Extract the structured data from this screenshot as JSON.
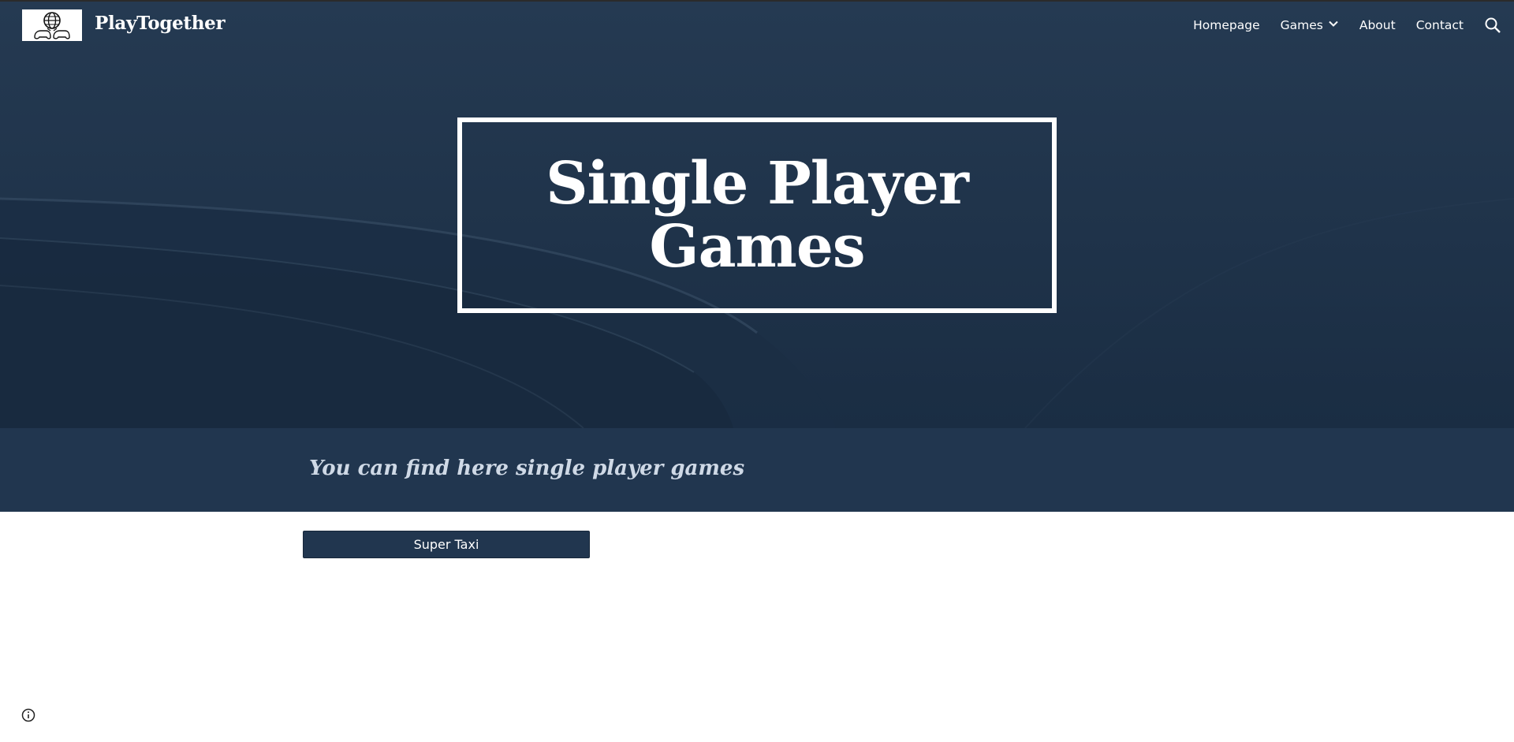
{
  "site": {
    "title": "PlayTogether",
    "logo_icon": "globe-gamepad-icon"
  },
  "nav": {
    "items": [
      {
        "label": "Homepage"
      },
      {
        "label": "Games",
        "icon": "chevron-down-icon"
      },
      {
        "label": "About"
      },
      {
        "label": "Contact"
      }
    ],
    "search_icon": "search-icon"
  },
  "hero": {
    "title": "Single Player Games",
    "background_color": "#1d3148"
  },
  "band": {
    "text": "You can find here single player games",
    "background_color": "#21364f"
  },
  "main": {
    "buttons": [
      {
        "label": "Super Taxi"
      }
    ]
  },
  "footer": {
    "info_icon": "info-icon"
  }
}
